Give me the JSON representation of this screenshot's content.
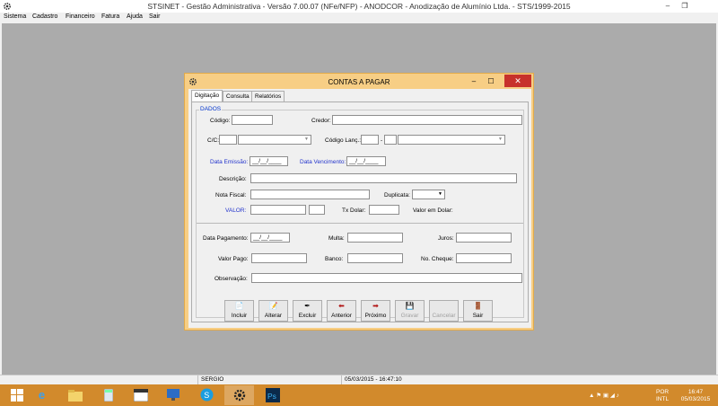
{
  "window": {
    "title": "STSINET - Gestão Administrativa - Versão 7.00.07 (NFe/NFP) - ANODCOR - Anodização de Alumínio Ltda. -  STS/1999-2015",
    "minimize_glyph": "–",
    "restore_glyph": "❐",
    "app_icon": "gear-icon"
  },
  "menu": [
    "Sistema",
    "Cadastro",
    "Financeiro",
    "Fatura",
    "Ajuda",
    "Sair"
  ],
  "dialog": {
    "title": "CONTAS A PAGAR",
    "minimize_glyph": "–",
    "maximize_glyph": "☐",
    "close_glyph": "✕",
    "tabs": [
      "Digitação",
      "Consulta",
      "Relatórios"
    ],
    "group_title": "DADOS",
    "labels": {
      "codigo": "Código:",
      "credor": "Credor:",
      "cc": "C/C:",
      "codigo_lanc": "Código Lanç.:",
      "dash": "-",
      "data_emissao": "Data Emissão:",
      "data_vencimento": "Data Vencimento:",
      "descricao": "Descrição:",
      "nota_fiscal": "Nota Fiscal:",
      "duplicata": "Duplicata:",
      "valor": "VALOR:",
      "tx_dolar": "Tx Dolar:",
      "valor_dolar": "Valor em Dolar:",
      "data_pagamento": "Data Pagamento:",
      "multa": "Multa:",
      "juros": "Juros:",
      "valor_pago": "Valor Pago:",
      "banco": "Banco:",
      "no_cheque": "No. Cheque:",
      "observacao": "Observação:"
    },
    "values": {
      "data_emissao": "__/__/____",
      "data_vencimento": "__/__/____",
      "data_pagamento": "__/__/____"
    },
    "buttons": [
      {
        "label": "Incluir",
        "icon": "📄"
      },
      {
        "label": "Alterar",
        "icon": "📝"
      },
      {
        "label": "Excluir",
        "icon": "✒"
      },
      {
        "label": "Anterior",
        "icon": "⬅"
      },
      {
        "label": "Próximo",
        "icon": "➡"
      },
      {
        "label": "Gravar",
        "icon": "💾"
      },
      {
        "label": "Cancelar",
        "icon": ""
      },
      {
        "label": "Sair",
        "icon": "🚪"
      }
    ]
  },
  "status_bar": {
    "user": "SERGIO",
    "datetime": "05/03/2015 - 16:47:10"
  },
  "taskbar": {
    "items": [
      "windows-start-icon",
      "internet-explorer-icon",
      "file-explorer-icon",
      "calculator-icon",
      "calendar-icon",
      "remote-desktop-icon",
      "skype-icon",
      "stsinet-app-icon",
      "photoshop-icon"
    ],
    "language": "POR",
    "layout": "INTL",
    "time": "16:47",
    "date": "05/03/2015",
    "colors": {
      "taskbar": "#d28a2c",
      "dialog_border": "#f7ce85",
      "close": "#c7312b"
    }
  }
}
